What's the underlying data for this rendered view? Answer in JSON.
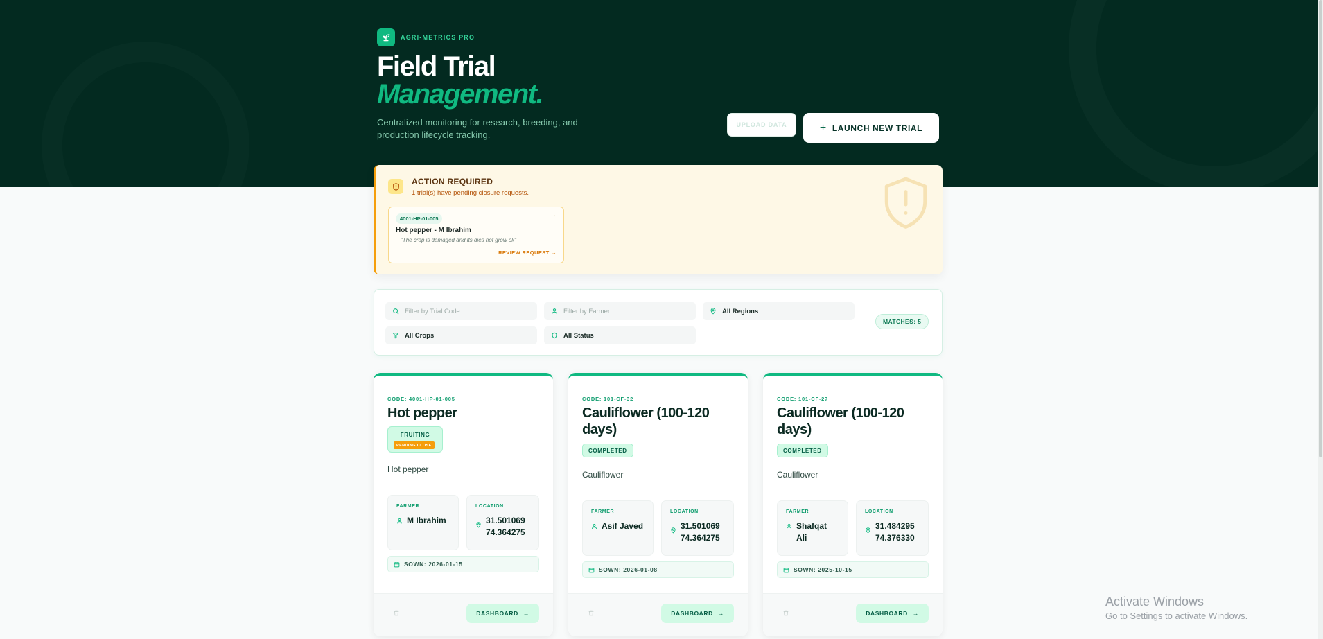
{
  "brand": {
    "name": "AGRI-METRICS PRO",
    "icon": "sprout-icon"
  },
  "header": {
    "title_line1": "Field Trial",
    "title_line2": "Management.",
    "subtitle": "Centralized monitoring for research, breeding, and production lifecycle tracking.",
    "upload_label": "UPLOAD DATA",
    "launch_label": "LAUNCH NEW TRIAL"
  },
  "alert": {
    "title": "ACTION REQUIRED",
    "subtitle": "1 trial(s) have pending closure requests.",
    "request": {
      "code": "4001-HP-01-005",
      "name": "Hot pepper - M Ibrahim",
      "quote": "\"The crop is damaged and its dies not grow ok\"",
      "review_label": "REVIEW REQUEST →"
    }
  },
  "filters": {
    "trial_code_placeholder": "Filter by Trial Code...",
    "farmer_placeholder": "Filter by Farmer...",
    "region_value": "All Regions",
    "crop_value": "All Crops",
    "status_value": "All Status",
    "matches_label": "MATCHES: 5"
  },
  "cards": [
    {
      "code": "CODE: 4001-HP-01-005",
      "name": "Hot pepper",
      "status": "FRUITING",
      "pending": "PENDING CLOSE",
      "crop": "Hot pepper",
      "farmer_label": "FARMER",
      "farmer": "M Ibrahim",
      "location_label": "LOCATION",
      "lat": "31.501069",
      "lng": "74.364275",
      "sown": "SOWN: 2026-01-15",
      "dashboard_label": "DASHBOARD"
    },
    {
      "code": "CODE: 101-CF-32",
      "name": "Cauliflower (100-120 days)",
      "status": "COMPLETED",
      "crop": "Cauliflower",
      "farmer_label": "FARMER",
      "farmer": "Asif Javed",
      "location_label": "LOCATION",
      "lat": "31.501069",
      "lng": "74.364275",
      "sown": "SOWN: 2026-01-08",
      "dashboard_label": "DASHBOARD"
    },
    {
      "code": "CODE: 101-CF-27",
      "name": "Cauliflower (100-120 days)",
      "status": "COMPLETED",
      "crop": "Cauliflower",
      "farmer_label": "FARMER",
      "farmer": "Shafqat Ali",
      "location_label": "LOCATION",
      "lat": "31.484295",
      "lng": "74.376330",
      "sown": "SOWN: 2025-10-15",
      "dashboard_label": "DASHBOARD"
    }
  ],
  "watermark": {
    "line1": "Activate Windows",
    "line2": "Go to Settings to activate Windows."
  },
  "colors": {
    "hero_bg": "#032a20",
    "accent": "#10b981",
    "warning": "#f59e0b"
  }
}
